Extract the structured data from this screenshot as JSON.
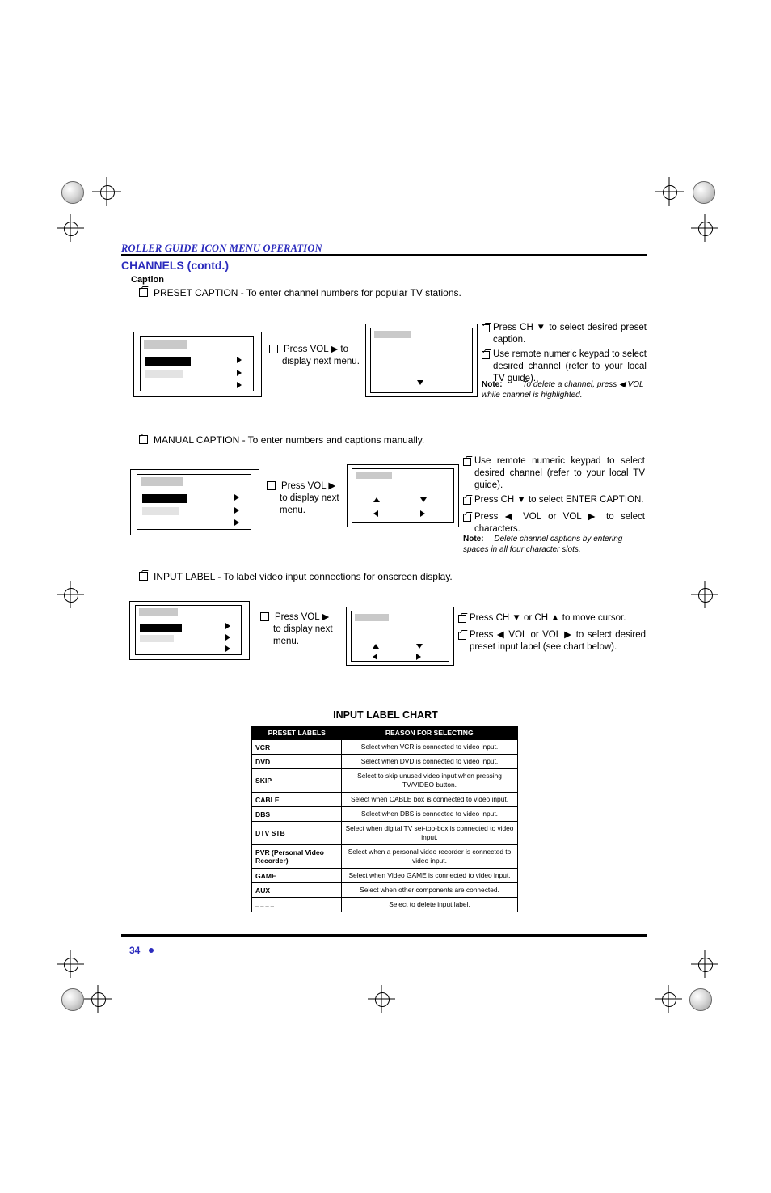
{
  "header": {
    "running_head": "ROLLER GUIDE ICON MENU OPERATION",
    "section_title": "CHANNELS (contd.)",
    "subsection": "Caption"
  },
  "items": [
    {
      "label": "PRESET CAPTION -  To enter channel numbers for popular TV stations."
    },
    {
      "label": "MANUAL CAPTION -  To enter numbers and captions manually."
    },
    {
      "label": "INPUT LABEL -  To label video input connections for onscreen display."
    }
  ],
  "blocks": {
    "preset": {
      "press_line1": "Press  VOL ▶  to",
      "press_line2": "display next menu.",
      "steps": [
        "Press CH ▼ to select desired preset caption.",
        "Use remote numeric keypad to select desired channel (refer to your local TV guide)."
      ],
      "note_label": "Note:",
      "note_text": "To delete a channel, press ◀ VOL while channel is highlighted."
    },
    "manual": {
      "press_line1": "Press  VOL ▶",
      "press_line2": "to display next",
      "press_line3": "menu.",
      "steps": [
        "Use remote numeric keypad to select desired channel (refer to your local TV guide).",
        "Press CH ▼ to select ENTER CAPTION.",
        "Press ◀ VOL or VOL ▶ to select characters."
      ],
      "note_label": "Note:",
      "note_text": "Delete channel captions by entering spaces in all four character slots."
    },
    "input": {
      "press_line1": "Press  VOL ▶",
      "press_line2": "to  display  next",
      "press_line3": "menu.",
      "steps": [
        "Press CH ▼ or CH ▲ to move cursor.",
        "Press ◀ VOL or VOL ▶ to select desired preset input label (see chart below)."
      ]
    }
  },
  "chart": {
    "title": "INPUT LABEL CHART",
    "headers": [
      "PRESET LABELS",
      "REASON FOR SELECTING"
    ],
    "rows": [
      {
        "label": "VCR",
        "reason": "Select when VCR is connected to video input."
      },
      {
        "label": "DVD",
        "reason": "Select when DVD is connected to video input."
      },
      {
        "label": "SKIP",
        "reason": "Select to skip unused video input when pressing TV/VIDEO button."
      },
      {
        "label": "CABLE",
        "reason": "Select when CABLE box is connected to video input."
      },
      {
        "label": "DBS",
        "reason": "Select when DBS is connected to video input."
      },
      {
        "label": "DTV STB",
        "reason": "Select when digital TV set-top-box is connected to video input."
      },
      {
        "label": "PVR (Personal Video Recorder)",
        "reason": "Select when a personal video recorder is connected to video input."
      },
      {
        "label": "GAME",
        "reason": "Select when Video GAME is connected to video input."
      },
      {
        "label": "AUX",
        "reason": "Select when other components are connected."
      },
      {
        "label": "_ _ _ _",
        "reason": "Select to delete input label."
      }
    ]
  },
  "footer": {
    "page_number": "34"
  },
  "colors": {
    "accent": "#2b2bbd",
    "rule": "#000000"
  }
}
